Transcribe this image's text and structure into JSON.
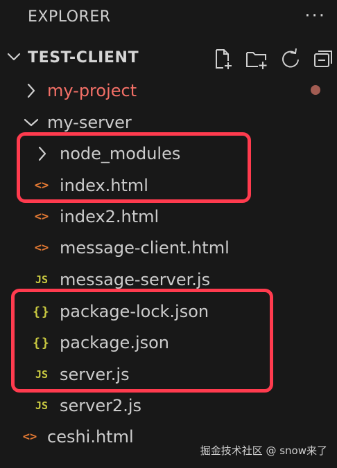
{
  "panel": {
    "title": "EXPLORER",
    "more_icon": "ellipsis-icon"
  },
  "section": {
    "title": "TEST-CLIENT",
    "toolbar": [
      "new-file-icon",
      "new-folder-icon",
      "refresh-icon",
      "collapse-all-icon"
    ]
  },
  "tree": {
    "items": [
      {
        "label": "my-project",
        "icon": "chevron-right-icon",
        "color": "#f47067"
      },
      {
        "label": "my-server",
        "icon": "chevron-down-icon"
      },
      {
        "label": "node_modules",
        "icon": "chevron-right-icon"
      },
      {
        "label": "index.html",
        "icon": "html-icon",
        "glyph": "<>"
      },
      {
        "label": "index2.html",
        "icon": "html-icon",
        "glyph": "<>"
      },
      {
        "label": "message-client.html",
        "icon": "html-icon",
        "glyph": "<>"
      },
      {
        "label": "message-server.js",
        "icon": "js-icon",
        "glyph": "JS"
      },
      {
        "label": "package-lock.json",
        "icon": "json-icon",
        "glyph": "{}"
      },
      {
        "label": "package.json",
        "icon": "json-icon",
        "glyph": "{}"
      },
      {
        "label": "server.js",
        "icon": "js-icon",
        "glyph": "JS"
      },
      {
        "label": "server2.js",
        "icon": "js-icon",
        "glyph": "JS"
      },
      {
        "label": "ceshi.html",
        "icon": "html-icon",
        "glyph": "<>"
      }
    ]
  },
  "colors": {
    "background": "#181818",
    "highlight": "#ff3b4e",
    "modified_dot": "#a25c52"
  },
  "watermark": "掘金技术社区 @ snow来了"
}
